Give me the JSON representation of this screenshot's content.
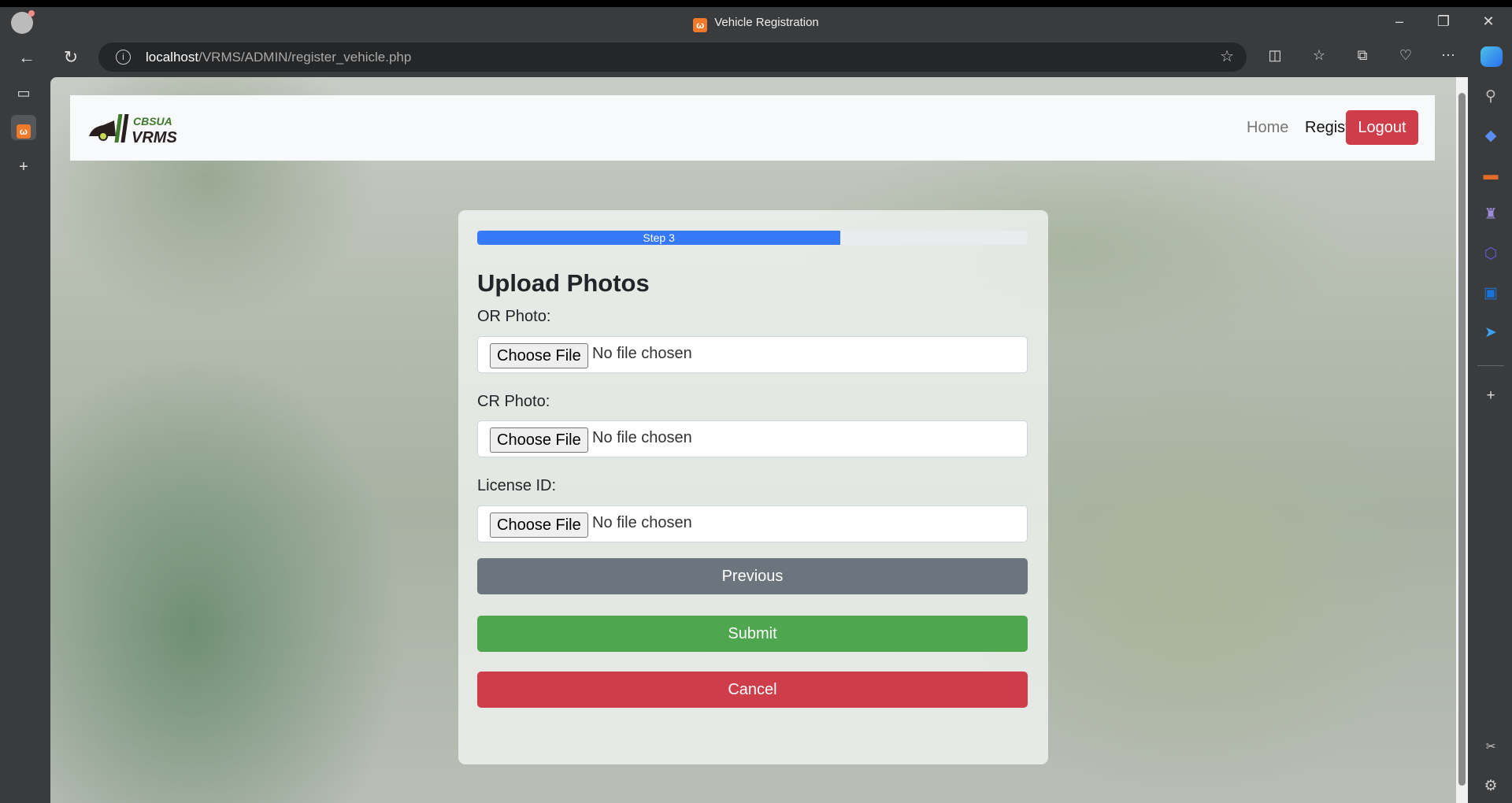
{
  "browser": {
    "tab_title": "Vehicle Registration",
    "url_host": "localhost",
    "url_path": "/VRMS/ADMIN/register_vehicle.php"
  },
  "navbar": {
    "logo_text": "CBSUA VRMS",
    "home": "Home",
    "registration": "Registration",
    "logout": "Logout"
  },
  "form": {
    "progress": {
      "label": "Step 3",
      "percent": 66
    },
    "heading": "Upload Photos",
    "fields": [
      {
        "label": "OR Photo:",
        "button": "Choose File",
        "status": "No file chosen"
      },
      {
        "label": "CR Photo:",
        "button": "Choose File",
        "status": "No file chosen"
      },
      {
        "label": "License ID:",
        "button": "Choose File",
        "status": "No file chosen"
      }
    ],
    "previous": "Previous",
    "submit": "Submit",
    "cancel": "Cancel"
  },
  "colors": {
    "primary": "#3579f6",
    "secondary": "#6c757d",
    "success": "#4ea64f",
    "danger": "#ce3d49"
  }
}
